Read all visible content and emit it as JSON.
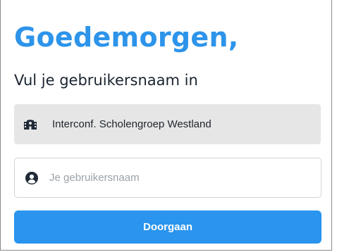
{
  "login": {
    "greeting": "Goedemorgen,",
    "subtitle": "Vul je gebruikersnaam in",
    "school": {
      "icon": "school-building-icon",
      "name": "Interconf. Scholengroep Westland"
    },
    "username": {
      "icon": "user-icon",
      "value": "",
      "placeholder": "Je gebruikersnaam"
    },
    "submit_label": "Doorgaan"
  },
  "colors": {
    "accent": "#2a94ee",
    "greeting": "#2d94ea",
    "school_box_bg": "#e6e6e6",
    "text_dark": "#1a2430",
    "placeholder": "#9aa1a8"
  }
}
